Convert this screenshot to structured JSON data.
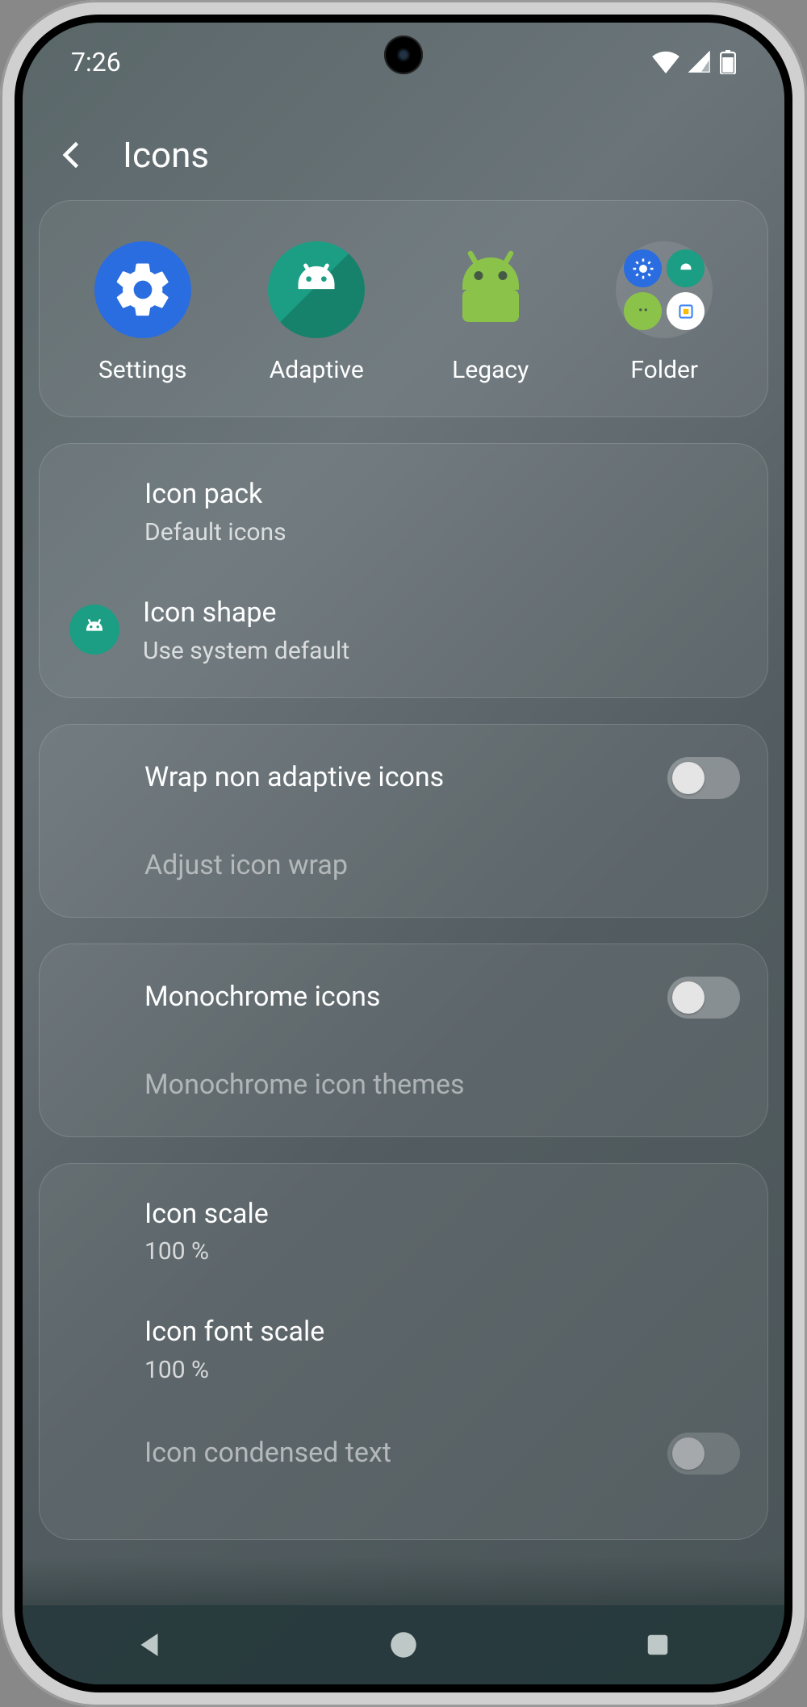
{
  "status": {
    "time": "7:26"
  },
  "header": {
    "title": "Icons"
  },
  "preview": {
    "items": [
      {
        "label": "Settings"
      },
      {
        "label": "Adaptive"
      },
      {
        "label": "Legacy"
      },
      {
        "label": "Folder"
      }
    ]
  },
  "rows": {
    "icon_pack": {
      "title": "Icon pack",
      "subtitle": "Default icons"
    },
    "icon_shape": {
      "title": "Icon shape",
      "subtitle": "Use system default"
    },
    "wrap": {
      "title": "Wrap non adaptive icons",
      "enabled": false
    },
    "adjust_wrap": {
      "title": "Adjust icon wrap"
    },
    "mono": {
      "title": "Monochrome icons",
      "enabled": false
    },
    "mono_themes": {
      "title": "Monochrome icon themes"
    },
    "icon_scale": {
      "title": "Icon scale",
      "subtitle": "100 %"
    },
    "font_scale": {
      "title": "Icon font scale",
      "subtitle": "100 %"
    },
    "condensed": {
      "title": "Icon condensed text",
      "enabled": false
    }
  }
}
